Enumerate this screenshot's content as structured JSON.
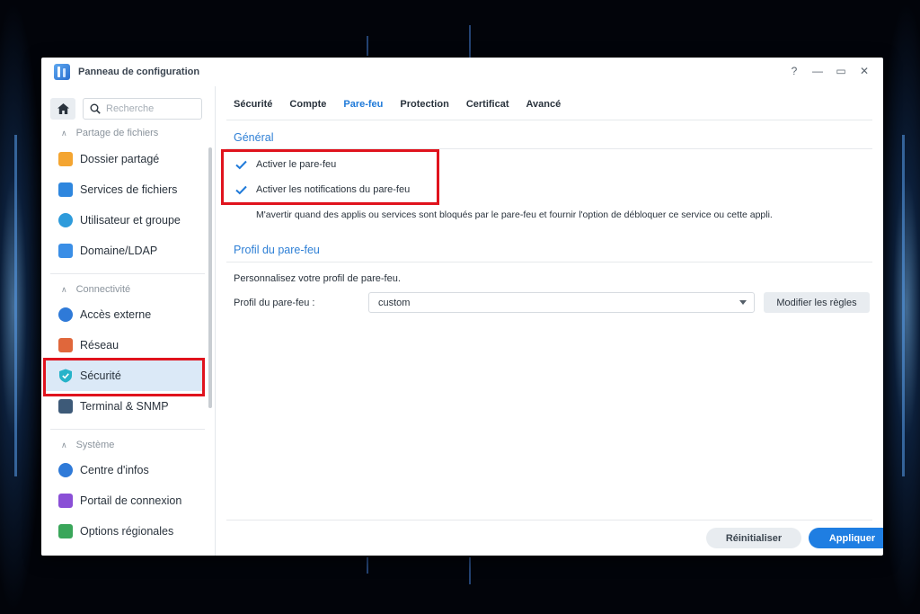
{
  "window": {
    "title": "Panneau de configuration",
    "controls": {
      "help": "?",
      "minimize": "—",
      "maximize": "▭",
      "close": "✕"
    }
  },
  "sidebar": {
    "search_placeholder": "Recherche",
    "sections": [
      {
        "label": "Partage de fichiers",
        "items": [
          {
            "label": "Dossier partagé",
            "icon": "folder-icon",
            "color": "#f4a531"
          },
          {
            "label": "Services de fichiers",
            "icon": "file-services-icon",
            "color": "#2e86de"
          },
          {
            "label": "Utilisateur et groupe",
            "icon": "users-icon",
            "color": "#2e9bdb"
          },
          {
            "label": "Domaine/LDAP",
            "icon": "domain-icon",
            "color": "#3a8ee6"
          }
        ]
      },
      {
        "label": "Connectivité",
        "items": [
          {
            "label": "Accès externe",
            "icon": "external-access-icon",
            "color": "#2f7ad8"
          },
          {
            "label": "Réseau",
            "icon": "network-icon",
            "color": "#e0673b"
          },
          {
            "label": "Sécurité",
            "icon": "shield-icon",
            "color": "#26b3c9",
            "active": true
          },
          {
            "label": "Terminal & SNMP",
            "icon": "terminal-icon",
            "color": "#3d5a78"
          }
        ]
      },
      {
        "label": "Système",
        "items": [
          {
            "label": "Centre d'infos",
            "icon": "info-icon",
            "color": "#2f7ad8"
          },
          {
            "label": "Portail de connexion",
            "icon": "login-portal-icon",
            "color": "#8a4fd6"
          },
          {
            "label": "Options régionales",
            "icon": "regional-options-icon",
            "color": "#3aa65a"
          }
        ]
      }
    ]
  },
  "tabs": [
    "Sécurité",
    "Compte",
    "Pare-feu",
    "Protection",
    "Certificat",
    "Avancé"
  ],
  "active_tab": "Pare-feu",
  "general": {
    "title": "Général",
    "checkboxes": [
      {
        "label": "Activer le pare-feu",
        "checked": true
      },
      {
        "label": "Activer les notifications du pare-feu",
        "checked": true
      }
    ],
    "hint": "M'avertir quand des applis ou services sont bloqués par le pare-feu et fournir l'option de débloquer ce service ou cette appli."
  },
  "profile": {
    "title": "Profil du pare-feu",
    "description": "Personnalisez votre profil de pare-feu.",
    "field_label": "Profil du pare-feu :",
    "selected": "custom",
    "edit_rules_button": "Modifier les règles"
  },
  "footer": {
    "reset_button": "Réinitialiser",
    "apply_button": "Appliquer"
  },
  "colors": {
    "accent": "#1f7ee2",
    "active_tab": "#1f7ad9",
    "highlight": "#e0131d",
    "active_nav_bg": "#dbe9f7"
  }
}
